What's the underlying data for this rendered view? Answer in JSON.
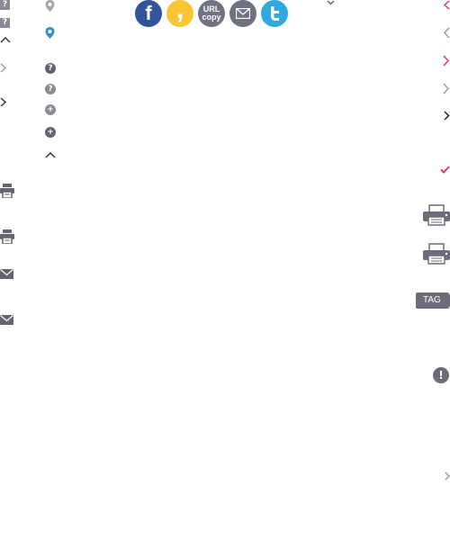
{
  "help_badges": [
    "?",
    "?"
  ],
  "share": {
    "facebook_glyph": "f",
    "kakao_glyph": ",",
    "url_copy_line1": "URL",
    "url_copy_line2": "copy",
    "colors": {
      "facebook": "#30559a",
      "kakao": "#f9c534",
      "url": "#6f7282",
      "mail": "#6f7282",
      "twitter": "#2fa9df"
    }
  },
  "help_circles": [
    "?",
    "?"
  ],
  "add_circles": [
    "+",
    "+"
  ],
  "tag_label": "TAG",
  "alert_glyph": "!",
  "accent_colors": {
    "pink": "#e0356b",
    "blue_pin": "#3b8fc9",
    "gray": "#9b9da6",
    "dark": "#333333"
  }
}
